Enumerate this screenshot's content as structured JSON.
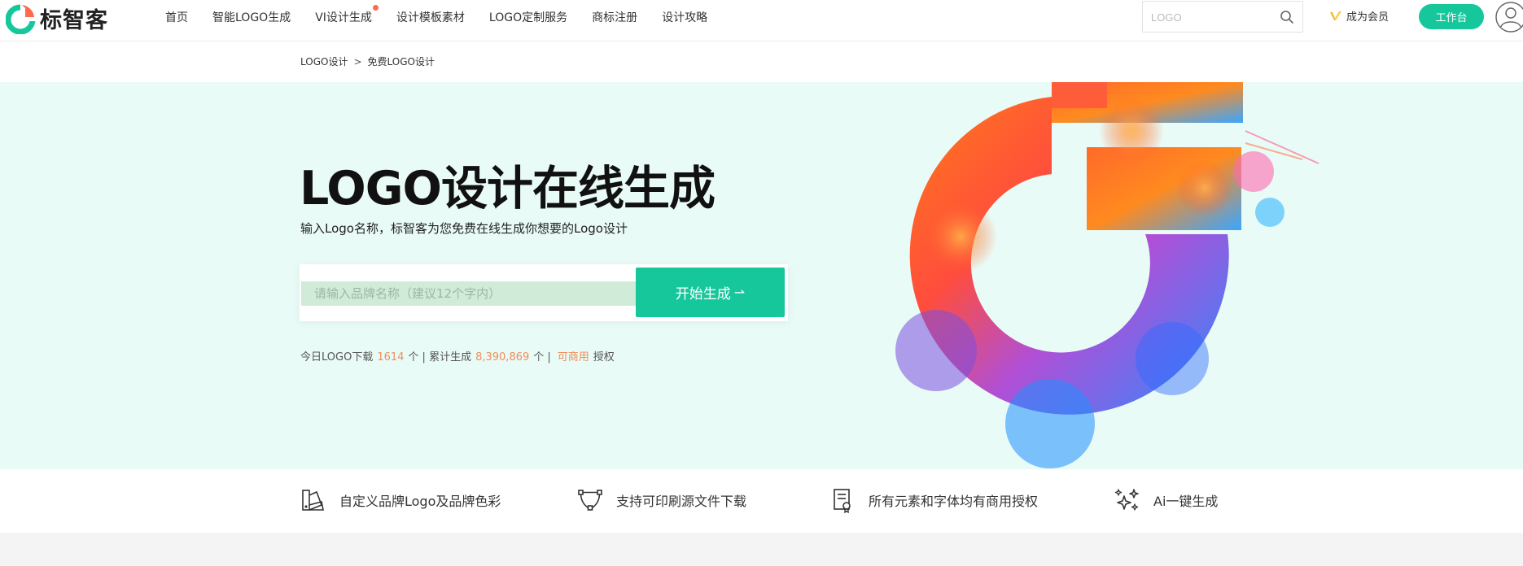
{
  "brand": {
    "name": "标智客",
    "accent": "#17c79c",
    "highlight": "#f08d5a"
  },
  "nav": {
    "items": [
      {
        "label": "首页"
      },
      {
        "label": "智能LOGO生成"
      },
      {
        "label": "VI设计生成",
        "badge": true
      },
      {
        "label": "设计模板素材"
      },
      {
        "label": "LOGO定制服务"
      },
      {
        "label": "商标注册"
      },
      {
        "label": "设计攻略"
      }
    ]
  },
  "search": {
    "placeholder": "LOGO",
    "icon": "search-icon"
  },
  "header_actions": {
    "vip_label": "成为会员",
    "workbench_label": "工作台",
    "avatar_icon": "user-icon"
  },
  "breadcrumb": {
    "items": [
      "LOGO设计",
      "免费LOGO设计"
    ],
    "separator": ">"
  },
  "hero": {
    "title": "LOGO设计在线生成",
    "subtitle": "输入Logo名称，标智客为您免费在线生成你想要的Logo设计",
    "input_placeholder": "请输入品牌名称（建议12个字内）",
    "button_label": "开始生成",
    "button_arrow": "⇀",
    "stats": {
      "today_label": "今日LOGO下载",
      "today_count": "1614",
      "today_unit": "个 |",
      "total_label": "累计生成",
      "total_count": "8,390,869",
      "total_unit": "个 |",
      "commercial_link": "可商用",
      "commercial_suffix": "授权"
    }
  },
  "features": [
    {
      "icon": "palette-icon",
      "label": "自定义品牌Logo及品牌色彩"
    },
    {
      "icon": "vector-path-icon",
      "label": "支持可印刷源文件下载"
    },
    {
      "icon": "certificate-icon",
      "label": "所有元素和字体均有商用授权"
    },
    {
      "icon": "sparkle-icon",
      "label": "Ai一键生成"
    }
  ]
}
